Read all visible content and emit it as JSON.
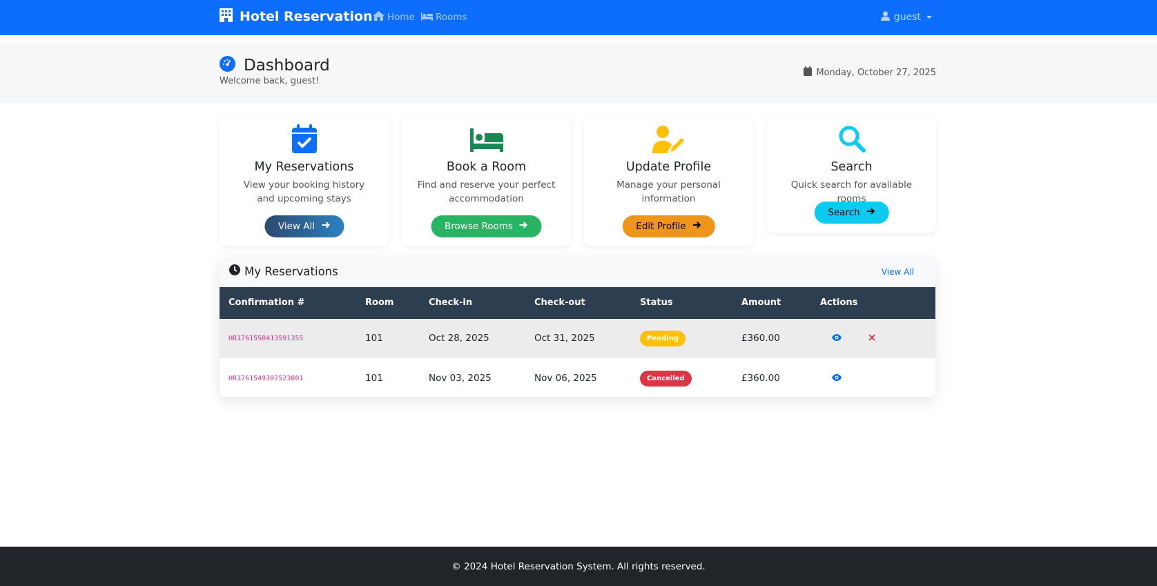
{
  "navbar": {
    "brand": "Hotel Reservation",
    "links": [
      "Home",
      "Rooms"
    ],
    "user": "guest"
  },
  "header": {
    "title": "Dashboard",
    "welcome": "Welcome back, guest!",
    "date": "Monday, October 27, 2025"
  },
  "cards": [
    {
      "title": "My Reservations",
      "desc": "View your booking history and upcoming stays",
      "button": "View All",
      "icon": "calendar-check-icon",
      "color": "#0d6efd"
    },
    {
      "title": "Book a Room",
      "desc": "Find and reserve your perfect accommodation",
      "button": "Browse Rooms",
      "icon": "bed-icon",
      "color": "#198754"
    },
    {
      "title": "Update Profile",
      "desc": "Manage your personal information",
      "button": "Edit Profile",
      "icon": "user-edit-icon",
      "color": "#ffc107"
    },
    {
      "title": "Search",
      "desc": "Quick search for available rooms",
      "button": "Search",
      "icon": "search-icon",
      "color": "#0dcaf0"
    }
  ],
  "reservations": {
    "title": "My Reservations",
    "view_all": "View All",
    "columns": [
      "Confirmation #",
      "Room",
      "Check-in",
      "Check-out",
      "Status",
      "Amount",
      "Actions"
    ],
    "rows": [
      {
        "confirmation": "HR1761550413591355",
        "room": "101",
        "checkin": "Oct 28, 2025",
        "checkout": "Oct 31, 2025",
        "status": "Pending",
        "amount": "£360.00"
      },
      {
        "confirmation": "HR1761549307523801",
        "room": "101",
        "checkin": "Nov 03, 2025",
        "checkout": "Nov 06, 2025",
        "status": "Cancelled",
        "amount": "£360.00"
      }
    ]
  },
  "footer": {
    "text": "© 2024 Hotel Reservation System. All rights reserved."
  }
}
